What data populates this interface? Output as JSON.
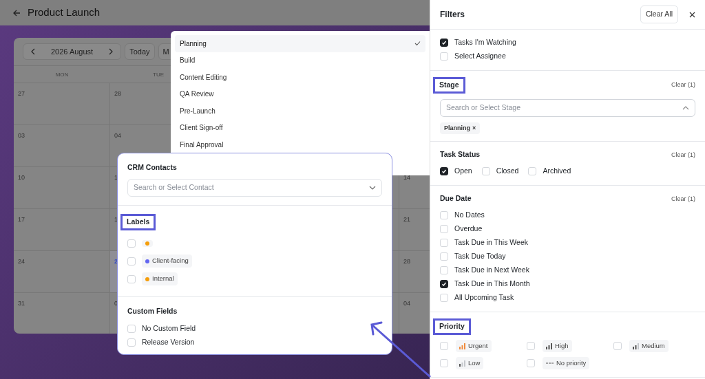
{
  "header": {
    "title": "Product Launch"
  },
  "calendar": {
    "period": "2026 August",
    "today_button": "Today",
    "view_button": "M",
    "weekdays": [
      "MON",
      "TUE"
    ],
    "weeks": [
      {
        "mon": {
          "day": "27",
          "today": false
        },
        "tue": {
          "day": "28",
          "today": false
        }
      },
      {
        "mon": {
          "day": "03",
          "today": false
        },
        "tue": {
          "day": "04",
          "today": false
        }
      },
      {
        "mon": {
          "day": "10",
          "today": false
        },
        "tue": {
          "day": "1",
          "today": false
        },
        "fri": {
          "day": "14",
          "today": false
        }
      },
      {
        "mon": {
          "day": "17",
          "today": false
        },
        "tue": {
          "day": "1",
          "today": false
        },
        "fri": {
          "day": "21",
          "today": false
        }
      },
      {
        "mon": {
          "day": "24",
          "today": false
        },
        "tue": {
          "day": "2",
          "today": true
        },
        "fri": {
          "day": "28",
          "today": false
        }
      },
      {
        "mon": {
          "day": "31",
          "today": false
        },
        "tue": {
          "day": "0",
          "today": false
        },
        "fri": {
          "day": "04",
          "today": false
        }
      }
    ]
  },
  "stage_menu": [
    {
      "label": "Planning",
      "selected": true
    },
    {
      "label": "Build",
      "selected": false
    },
    {
      "label": "Content Editing",
      "selected": false
    },
    {
      "label": "QA Review",
      "selected": false
    },
    {
      "label": "Pre-Launch",
      "selected": false
    },
    {
      "label": "Client Sign-off",
      "selected": false
    },
    {
      "label": "Final Approval",
      "selected": false
    }
  ],
  "zoom_panel": {
    "sections": [
      {
        "kind": "select",
        "title": "CRM Contacts",
        "highlighted": false,
        "placeholder": "Search or Select Contact"
      },
      {
        "kind": "labels",
        "title": "Labels",
        "highlighted": true,
        "options": [
          {
            "checked": false,
            "color": "#f59e0b"
          },
          {
            "checked": false,
            "color": "#6366f1",
            "label": "Client-facing"
          },
          {
            "checked": false,
            "color": "#f59e0b",
            "label": "Internal"
          }
        ]
      },
      {
        "kind": "checklist",
        "title": "Custom Fields",
        "highlighted": false,
        "options": [
          {
            "label": "No Custom Field",
            "checked": false
          },
          {
            "label": "Release Version",
            "checked": false
          }
        ]
      }
    ]
  },
  "filters": {
    "title": "Filters",
    "clear_all": "Clear All",
    "sections": [
      {
        "kind": "checklist",
        "options": [
          {
            "label": "Tasks I'm Watching",
            "checked": true
          },
          {
            "label": "Select Assignee",
            "checked": false
          }
        ]
      },
      {
        "kind": "select",
        "title": "Stage",
        "highlighted": true,
        "clear": "Clear (1)",
        "placeholder": "Search or Select Stage",
        "expanded": true,
        "chips": [
          {
            "label": "Planning",
            "remove": "×"
          }
        ]
      },
      {
        "kind": "inline",
        "title": "Task Status",
        "highlighted": false,
        "clear": "Clear (1)",
        "options": [
          {
            "label": "Open",
            "checked": true
          },
          {
            "label": "Closed",
            "checked": false
          },
          {
            "label": "Archived",
            "checked": false
          }
        ]
      },
      {
        "kind": "checklist",
        "title": "Due Date",
        "highlighted": false,
        "clear": "Clear (1)",
        "options": [
          {
            "label": "No Dates",
            "checked": false
          },
          {
            "label": "Overdue",
            "checked": false
          },
          {
            "label": "Task Due in This Week",
            "checked": false
          },
          {
            "label": "Task Due Today",
            "checked": false
          },
          {
            "label": "Task Due in Next Week",
            "checked": false
          },
          {
            "label": "Task Due in This Month",
            "checked": true
          },
          {
            "label": "All Upcoming Task",
            "checked": false
          }
        ]
      },
      {
        "kind": "priority",
        "title": "Priority",
        "highlighted": true,
        "options": [
          {
            "label": "Urgent",
            "kind": "urgent",
            "checked": false
          },
          {
            "label": "High",
            "kind": "high",
            "checked": false
          },
          {
            "label": "Medium",
            "kind": "medium",
            "checked": false
          },
          {
            "label": "Low",
            "kind": "low",
            "checked": false
          },
          {
            "label": "No priority",
            "kind": "none",
            "checked": false
          }
        ]
      }
    ]
  }
}
